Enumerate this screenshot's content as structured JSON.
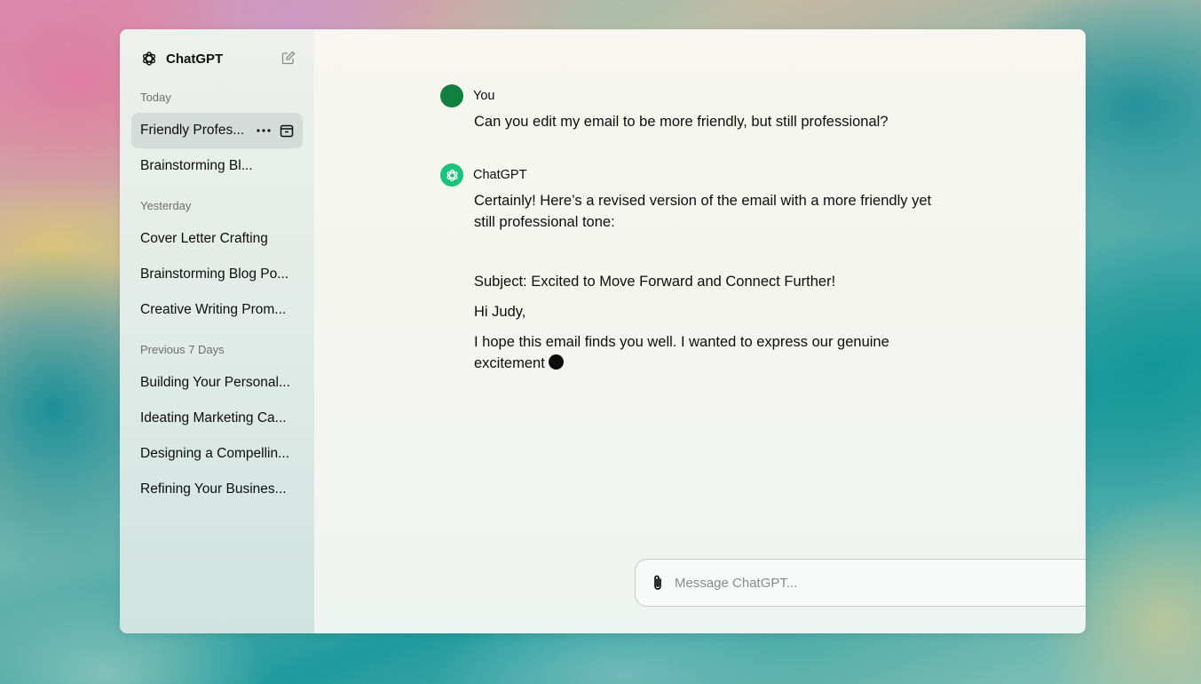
{
  "app": {
    "name": "ChatGPT"
  },
  "sidebar": {
    "sections": [
      {
        "label": "Today",
        "items": [
          "Friendly Profes...",
          "Brainstorming Bl..."
        ]
      },
      {
        "label": "Yesterday",
        "items": [
          "Cover Letter Crafting",
          "Brainstorming Blog Po...",
          "Creative Writing Prom..."
        ]
      },
      {
        "label": "Previous 7 Days",
        "items": [
          "Building Your Personal...",
          "Ideating Marketing Ca...",
          "Designing a Compellin...",
          "Refining Your Busines..."
        ]
      }
    ]
  },
  "conversation": {
    "user": {
      "author": "You",
      "text": "Can you edit my email to be more friendly, but still professional?"
    },
    "assistant": {
      "author": "ChatGPT",
      "intro": "Certainly! Here’s a revised version of the email with a more friendly yet still professional tone:",
      "subject": "Subject: Excited to Move Forward and Connect Further!",
      "greeting": "Hi Judy,",
      "body": "I hope this email finds you well. I wanted to express our genuine excitement"
    }
  },
  "composer": {
    "placeholder": "Message ChatGPT..."
  },
  "colors": {
    "user_avatar": "#10803f",
    "assistant_avatar": "#19c37d"
  },
  "icons": {
    "logo": "openai-logo-icon",
    "new_chat": "edit-icon",
    "more": "more-icon",
    "archive": "archive-icon",
    "attach": "paperclip-icon",
    "send": "arrow-up-icon"
  }
}
